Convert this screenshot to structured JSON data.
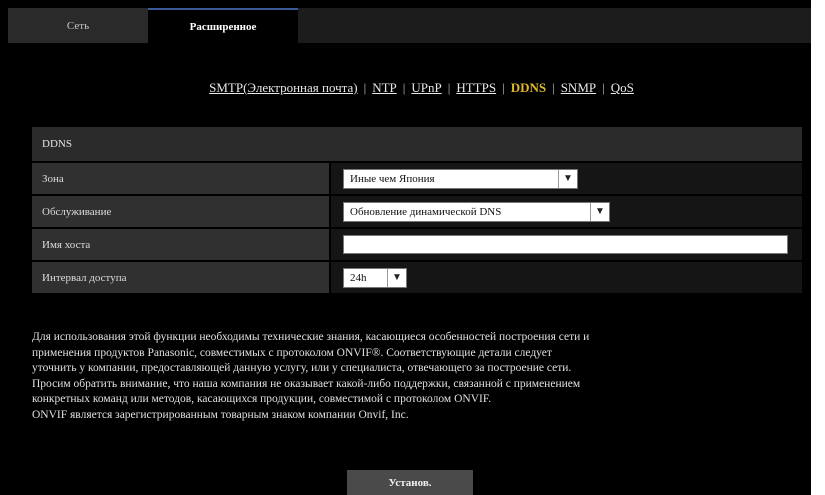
{
  "tabs": {
    "network": "Сеть",
    "advanced": "Расширенное"
  },
  "subnav": {
    "items": [
      "SMTP(Электронная почта)",
      "NTP",
      "UPnP",
      "HTTPS",
      "DDNS",
      "SNMP",
      "QoS"
    ],
    "active": "DDNS"
  },
  "ddns": {
    "title": "DDNS",
    "zone_label": "Зона",
    "zone_value": "Иные чем Япония",
    "service_label": "Обслуживание",
    "service_value": "Обновление динамической DNS",
    "hostname_label": "Имя хоста",
    "hostname_value": "",
    "interval_label": "Интервал доступа",
    "interval_value": "24h"
  },
  "note": {
    "lines": [
      "Для использования этой функции необходимы технические знания, касающиеся особенностей построения сети и",
      "применения продуктов Panasonic, совместимых с протоколом ONVIF®. Соответствующие детали следует",
      "уточнить у компании, предоставляющей данную услугу, или у специалиста, отвечающего за построение сети.",
      "Просим обратить внимание, что наша компания не оказывает какой-либо поддержки, связанной с применением",
      "конкретных команд или методов, касающихся продукции, совместимой с протоколом ONVIF.",
      "ONVIF является зарегистрированным товарным знаком компании Onvif, Inc."
    ]
  },
  "buttons": {
    "set": "Установ."
  },
  "colors": {
    "active_link": "#e0b829",
    "background": "#000000"
  }
}
